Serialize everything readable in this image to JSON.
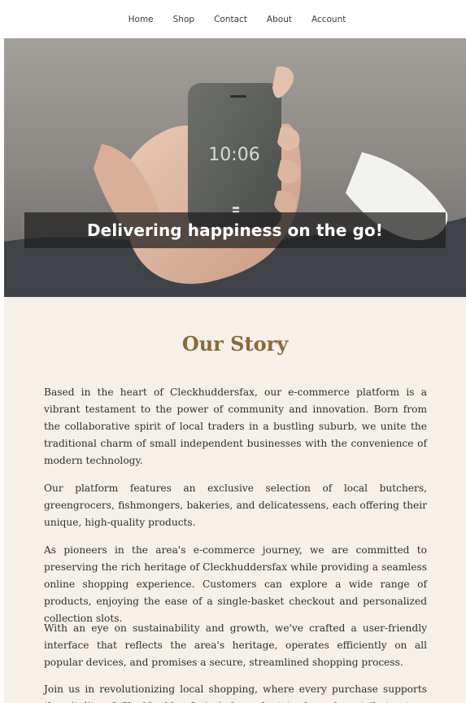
{
  "nav": {
    "items": [
      {
        "label": "Home"
      },
      {
        "label": "Shop"
      },
      {
        "label": "Contact"
      },
      {
        "label": "About"
      },
      {
        "label": "Account"
      }
    ]
  },
  "hero": {
    "title": "Delivering happiness on the go!",
    "phone_time": "10:06"
  },
  "story": {
    "title": "Our Story",
    "paragraphs": [
      "Based in the heart of Cleckhuddersfax, our e-commerce platform is a vibrant testament to the power of community and innovation. Born from the collaborative spirit of local traders in a bustling suburb, we unite the traditional charm of small independent businesses with the convenience of modern technology.",
      "Our platform features an exclusive selection of local butchers, greengrocers, fishmongers, bakeries, and delicatessens, each offering their unique, high-quality products.",
      "As pioneers in the area's e-commerce journey, we are committed to preserving the rich heritage of Cleckhuddersfax while providing a seamless online shopping experience. Customers can explore a wide range of products, enjoying the ease of a single-basket checkout and personalized collection slots.",
      "With an eye on sustainability and growth, we've crafted a user-friendly interface that reflects the area's heritage, operates efficiently on all popular devices, and promises a secure, streamlined shopping process.",
      "Join us in revolutionizing local shopping, where every purchase supports the vitality of Cleckhuddersfax's independent trade and contributes to a thriving"
    ]
  },
  "colors": {
    "story_title": "#8a6a3a",
    "background": "#f5f0e8",
    "banner": "#1e1e1e"
  }
}
